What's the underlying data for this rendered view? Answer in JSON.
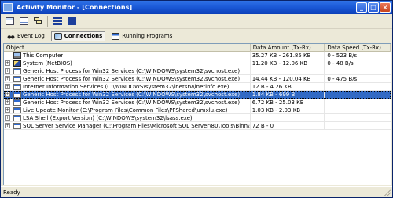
{
  "window": {
    "title": "Activity Monitor - [Connections]"
  },
  "titlebar_controls": {
    "minimize": "_",
    "maximize": "□",
    "close": "×"
  },
  "toolbar": {
    "buttons": [
      "tree-view",
      "list-view",
      "bars-large",
      "bars-small",
      "copy-stack"
    ]
  },
  "tabs": [
    {
      "label": "Event Log",
      "icon": "binoculars-icon",
      "active": false
    },
    {
      "label": "Connections",
      "icon": "network-icon",
      "active": true
    },
    {
      "label": "Running Programs",
      "icon": "programs-icon",
      "active": false
    }
  ],
  "table": {
    "columns": [
      "Object",
      "Data Amount (Tx-Rx)",
      "Data Speed (Tx-Rx)"
    ],
    "rows": [
      {
        "object": "This Computer",
        "amount": "35.27 KB - 261.85 KB",
        "speed": "0 - 523 B/s",
        "expander": false,
        "icon": "computer-icon",
        "selected": false
      },
      {
        "object": "System (NetBIOS)",
        "amount": "11.20 KB - 12.06 KB",
        "speed": "0 - 48 B/s",
        "expander": true,
        "icon": "system-icon",
        "selected": false
      },
      {
        "object": "Generic Host Process for Win32 Services (C:\\WINDOWS\\system32\\svchost.exe)",
        "amount": "",
        "speed": "",
        "expander": true,
        "icon": "process-icon",
        "selected": false
      },
      {
        "object": "Generic Host Process for Win32 Services (C:\\WINDOWS\\system32\\svchost.exe)",
        "amount": "14.44 KB - 120.04 KB",
        "speed": "0 - 475 B/s",
        "expander": true,
        "icon": "process-icon",
        "selected": false
      },
      {
        "object": "Internet Information Services (C:\\WINDOWS\\system32\\inetsrv\\inetinfo.exe)",
        "amount": "12 B - 4.26 KB",
        "speed": "",
        "expander": true,
        "icon": "process-icon",
        "selected": false
      },
      {
        "object": "Generic Host Process for Win32 Services (C:\\WINDOWS\\system32\\svchost.exe)",
        "amount": "1.84 KB - 699 B",
        "speed": "",
        "expander": true,
        "icon": "process-icon",
        "selected": true
      },
      {
        "object": "Generic Host Process for Win32 Services (C:\\WINDOWS\\system32\\svchost.exe)",
        "amount": "6.72 KB - 25.03 KB",
        "speed": "",
        "expander": true,
        "icon": "process-icon",
        "selected": false
      },
      {
        "object": "Live Update Monitor (C:\\Program Files\\Common Files\\PFShared\\umxlu.exe)",
        "amount": "1.03 KB - 2.03 KB",
        "speed": "",
        "expander": true,
        "icon": "process-icon",
        "selected": false
      },
      {
        "object": "LSA Shell (Export Version) (C:\\WINDOWS\\system32\\lsass.exe)",
        "amount": "",
        "speed": "",
        "expander": true,
        "icon": "process-icon",
        "selected": false
      },
      {
        "object": "SQL Server Service Manager (C:\\Program Files\\Microsoft SQL Server\\80\\Tools\\Binn\\sqlmangr...",
        "amount": "72 B - 0",
        "speed": "",
        "expander": true,
        "icon": "process-icon",
        "selected": false
      }
    ]
  },
  "status": {
    "text": "Ready"
  },
  "colors": {
    "titlebar": "#1c5ad8",
    "selection": "#316ac5",
    "frame": "#ece9d8"
  }
}
